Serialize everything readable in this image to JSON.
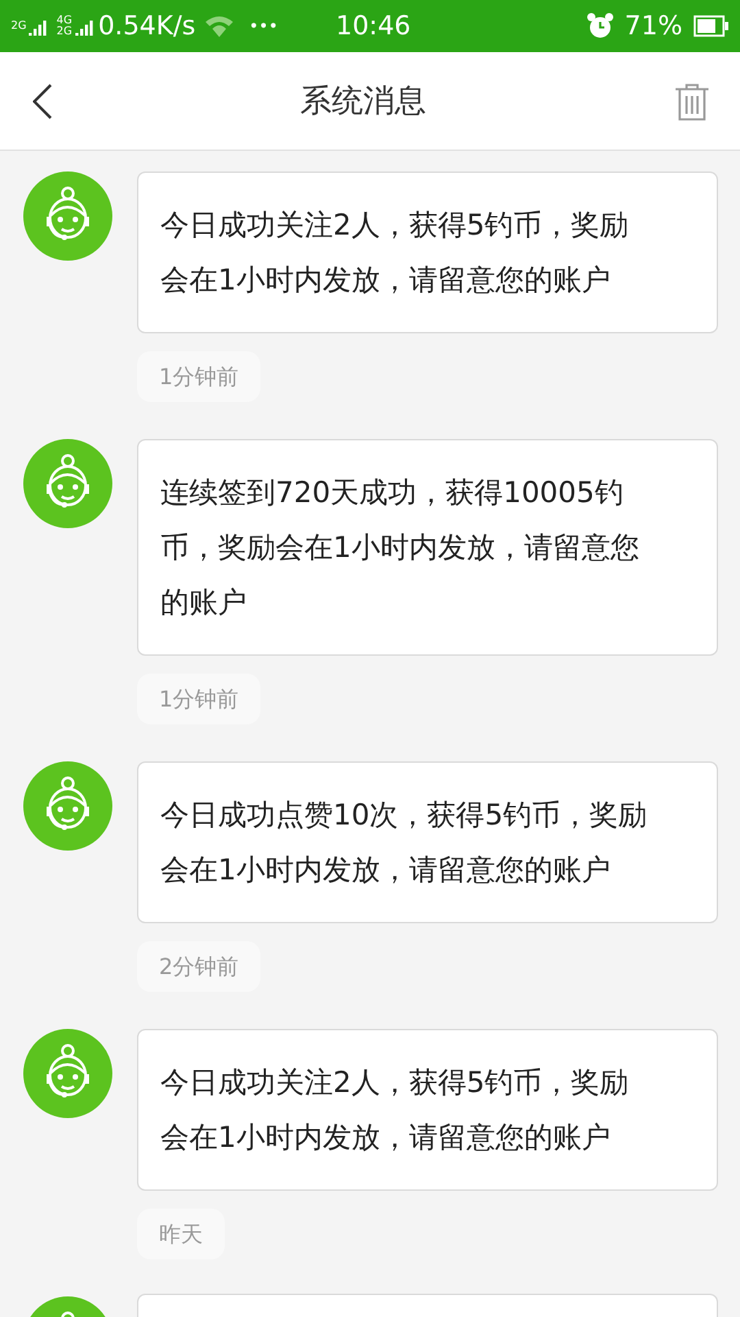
{
  "status_bar": {
    "sim1_label": "2G",
    "sim2_labels": [
      "4G",
      "2G"
    ],
    "speed": "0.54K/s",
    "more": "•••",
    "time": "10:46",
    "battery_text": "71%"
  },
  "header": {
    "title": "系统消息"
  },
  "messages": [
    {
      "kind": "message",
      "lines": [
        "今日成功关注2人，获得5钓币，奖励",
        "会在1小时内发放，请留意您的账户"
      ],
      "time": "1分钟前"
    },
    {
      "kind": "message",
      "lines": [
        "连续签到720天成功，获得10005钓",
        "币，奖励会在1小时内发放，请留意您",
        "的账户"
      ],
      "time": "1分钟前"
    },
    {
      "kind": "message",
      "lines": [
        "今日成功点赞10次，获得5钓币，奖励",
        "会在1小时内发放，请留意您的账户"
      ],
      "time": "2分钟前"
    },
    {
      "kind": "message",
      "lines": [
        "今日成功关注2人，获得5钓币，奖励",
        "会在1小时内发放，请留意您的账户"
      ],
      "time": "昨天"
    },
    {
      "kind": "cut"
    }
  ]
}
